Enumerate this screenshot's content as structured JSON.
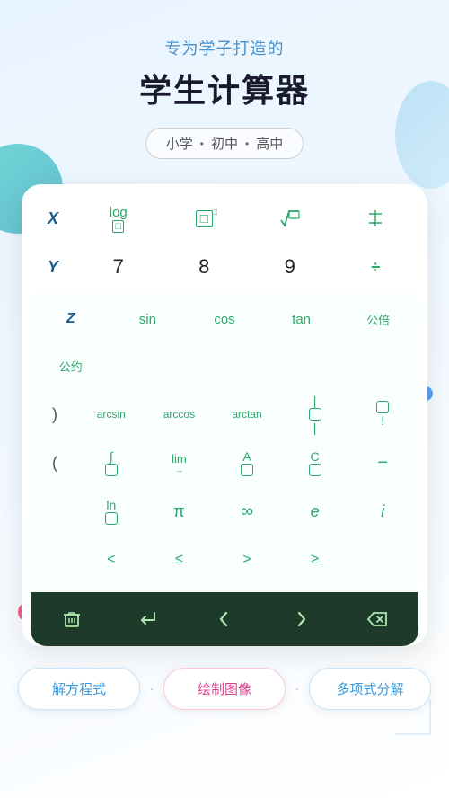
{
  "header": {
    "subtitle": "专为学子打造的",
    "title": "学生计算器",
    "levels": [
      "小学",
      "·",
      "初中",
      "·",
      "高中"
    ]
  },
  "calculator": {
    "row1": {
      "var": "X",
      "keys": [
        "log□",
        "□²",
        "√□",
        "÷"
      ]
    },
    "row2": {
      "var": "Y",
      "keys": [
        "7",
        "8",
        "9",
        "÷"
      ]
    },
    "expanded": {
      "row1": [
        "sin",
        "cos",
        "tan",
        "公倍",
        "公约"
      ],
      "row2": [
        "arcsin",
        "arccos",
        "arctan",
        "|□|",
        "□!"
      ],
      "row3": [
        "∫□",
        "lim→",
        "A□",
        "C□",
        "−"
      ],
      "row4": [
        "ln□",
        "π",
        "∞",
        "e",
        "i"
      ],
      "row5": [
        "<",
        "≤",
        ">",
        "≥",
        ""
      ]
    },
    "toolbar": {
      "keys": [
        "🗑",
        "↵",
        "◄",
        "►",
        "⌫"
      ]
    }
  },
  "functions": {
    "solve": "解方程式",
    "separator1": "·",
    "graph": "绘制图像",
    "separator2": "·",
    "poly": "多项式分解"
  }
}
